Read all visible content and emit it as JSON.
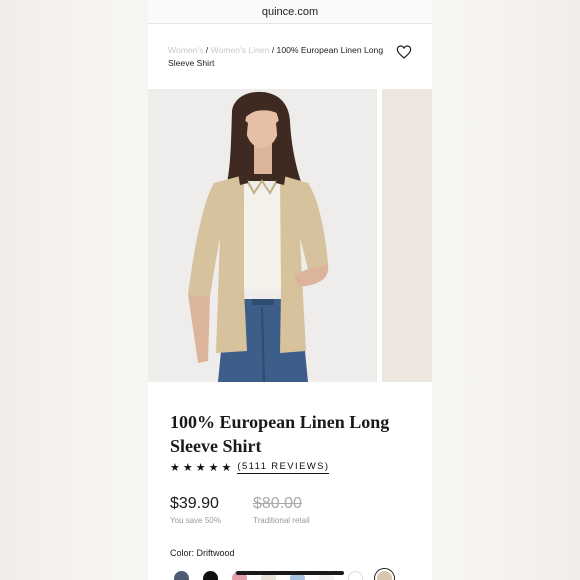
{
  "browser": {
    "url": "quince.com"
  },
  "breadcrumb": {
    "items": [
      "Women's",
      "Women's Linen"
    ],
    "separator": "/",
    "current": "100% European Linen Long Sleeve Shirt"
  },
  "product": {
    "title": "100% European Linen Long Sleeve Shirt",
    "rating": {
      "stars": 5,
      "reviews_label": "(5111 REVIEWS)"
    },
    "price": "$39.90",
    "savings": "You save 50%",
    "retail_price": "$80.00",
    "retail_label": "Traditional retail"
  },
  "color": {
    "label": "Color: Driftwood",
    "swatches": [
      "#4d5b73",
      "#111111",
      "#e3a0a8",
      "#e6e2da",
      "#a6c3e2",
      "#f2f2f2",
      "#ffffff",
      "#d8c7ad"
    ]
  },
  "icons": {
    "heart": "heart-icon",
    "star": "star-icon"
  }
}
